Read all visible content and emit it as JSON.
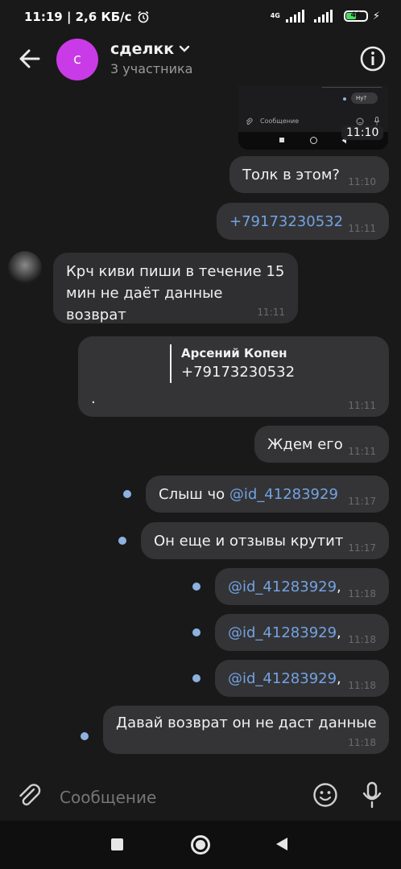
{
  "status": {
    "time_speed": "11:19 | 2,6 КБ/с",
    "network": "4G",
    "battery": "46"
  },
  "header": {
    "title": "сделкк",
    "subtitle": "3 участника",
    "avatar_letter": "с"
  },
  "screenshot_preview": {
    "bubble": "Ну?",
    "input_placeholder": "Сообщение",
    "time": "11:10"
  },
  "messages": [
    {
      "text": "Толк в этом?",
      "time": "11:10"
    },
    {
      "text": "+79173230532",
      "time": "11:11"
    },
    {
      "text": "Крч киви пиши в течение 15 мин не даёт данные возврат",
      "time": "11:11"
    },
    {
      "quote_author": "Арсений Копен",
      "quote_text": "+79173230532",
      "text": ".",
      "time": "11:11"
    },
    {
      "text": "Ждем его",
      "time": "11:11"
    },
    {
      "text": "Слыш чо",
      "mention": "@id_41283929",
      "time": "11:17"
    },
    {
      "text": "Он еще и отзывы крутит",
      "time": "11:17"
    },
    {
      "mention": "@id_41283929",
      "suffix": ",",
      "time": "11:18"
    },
    {
      "mention": "@id_41283929",
      "suffix": ",",
      "time": "11:18"
    },
    {
      "mention": "@id_41283929",
      "suffix": ",",
      "time": "11:18"
    },
    {
      "text": "Давай возврат он не даст данные",
      "time": "11:18"
    }
  ],
  "composer": {
    "placeholder": "Сообщение"
  },
  "colors": {
    "background": "#19191a",
    "bubble": "#343436",
    "link": "#73a2e3",
    "unread_dot": "#8db1e0",
    "avatar": "#c93be6"
  }
}
